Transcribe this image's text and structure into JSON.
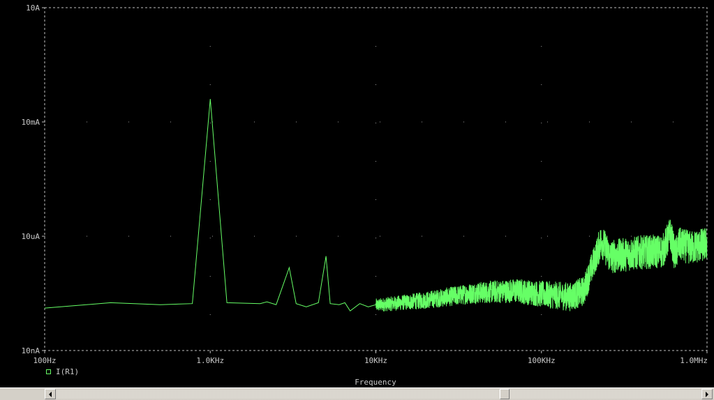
{
  "chart_data": {
    "type": "line",
    "title": "",
    "xlabel": "Frequency",
    "ylabel": "",
    "x_scale": "log",
    "y_scale": "log",
    "xlim": [
      100,
      1000000
    ],
    "ylim": [
      1e-08,
      10
    ],
    "x_ticks": [
      {
        "value": 100,
        "label": "100Hz"
      },
      {
        "value": 1000,
        "label": "1.0KHz"
      },
      {
        "value": 10000,
        "label": "10KHz"
      },
      {
        "value": 100000,
        "label": "100KHz"
      },
      {
        "value": 1000000,
        "label": "1.0MHz"
      }
    ],
    "y_ticks": [
      {
        "value": 1e-08,
        "label": "10nA"
      },
      {
        "value": 1e-05,
        "label": "10uA"
      },
      {
        "value": 0.01,
        "label": "10mA"
      },
      {
        "value": 10,
        "label": "10A"
      }
    ],
    "grid": true,
    "legend_position": "bottom-left",
    "series": [
      {
        "name": "I(R1)",
        "color": "#66ff66",
        "points": [
          [
            100,
            1.3e-07
          ],
          [
            250,
            1.8e-07
          ],
          [
            500,
            1.6e-07
          ],
          [
            780,
            1.7e-07
          ],
          [
            1000,
            0.04
          ],
          [
            1260,
            1.8e-07
          ],
          [
            2000,
            1.7e-07
          ],
          [
            2200,
            1.9e-07
          ],
          [
            2500,
            1.6e-07
          ],
          [
            3000,
            1.5e-06
          ],
          [
            3300,
            1.7e-07
          ],
          [
            3800,
            1.4e-07
          ],
          [
            4500,
            1.8e-07
          ],
          [
            5000,
            3e-06
          ],
          [
            5300,
            1.7e-07
          ],
          [
            6000,
            1.6e-07
          ],
          [
            6500,
            1.8e-07
          ],
          [
            7000,
            1.1e-07
          ],
          [
            8000,
            1.7e-07
          ],
          [
            9000,
            1.4e-07
          ],
          [
            10000,
            1.6e-07
          ],
          [
            20000,
            2.2e-07
          ],
          [
            40000,
            3.5e-07
          ],
          [
            70000,
            4e-07
          ],
          [
            100000,
            3.3e-07
          ],
          [
            150000,
            2.8e-07
          ],
          [
            180000,
            4e-07
          ],
          [
            230000,
            8.5e-06
          ],
          [
            260000,
            3.2e-06
          ],
          [
            400000,
            4.2e-06
          ],
          [
            540000,
            4.5e-06
          ],
          [
            600000,
            1.3e-05
          ],
          [
            640000,
            3.5e-06
          ],
          [
            680000,
            6.8e-06
          ],
          [
            800000,
            5.5e-06
          ],
          [
            1000000,
            7e-06
          ]
        ]
      }
    ]
  }
}
